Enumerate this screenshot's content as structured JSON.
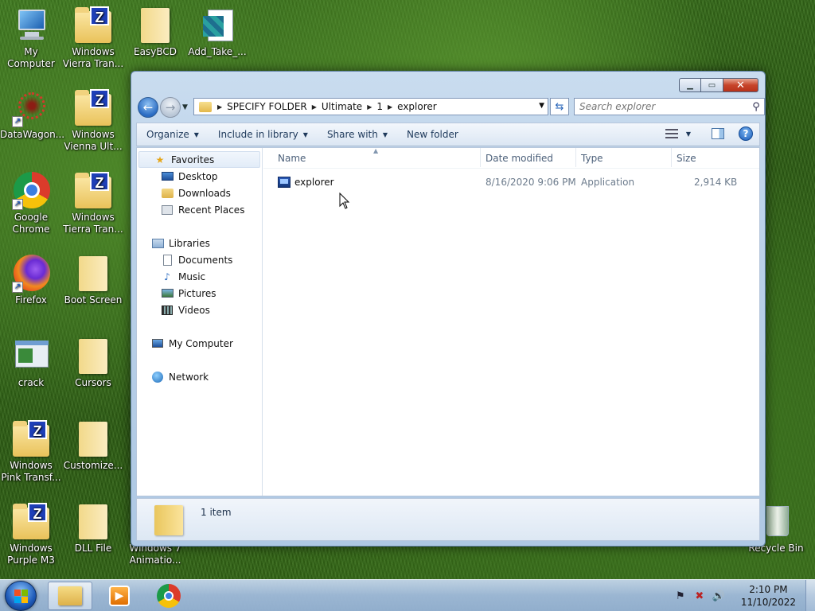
{
  "desktop": {
    "icons": [
      {
        "label": "My Computer",
        "icon": "computer-icon"
      },
      {
        "label": "Windows Vierra Tran...",
        "icon": "folder-z-icon"
      },
      {
        "label": "EasyBCD",
        "icon": "folder-icon"
      },
      {
        "label": "Add_Take_...",
        "icon": "registry-icon"
      },
      {
        "label": "DataWagon...",
        "icon": "shortcut-icon"
      },
      {
        "label": "Windows Vienna Ult...",
        "icon": "folder-z-icon"
      },
      {
        "label": "Google Chrome",
        "icon": "chrome-icon"
      },
      {
        "label": "Windows Tierra Tran...",
        "icon": "folder-z-icon"
      },
      {
        "label": "Firefox",
        "icon": "firefox-icon"
      },
      {
        "label": "Boot Screen",
        "icon": "folder-icon"
      },
      {
        "label": "crack",
        "icon": "window-app-icon"
      },
      {
        "label": "Cursors",
        "icon": "folder-icon"
      },
      {
        "label": "Windows Pink Transf...",
        "icon": "folder-z-icon"
      },
      {
        "label": "Customize...",
        "icon": "folder-icon"
      },
      {
        "label": "Windows Purple M3",
        "icon": "folder-z-icon"
      },
      {
        "label": "DLL File",
        "icon": "folder-icon"
      },
      {
        "label": "Windows 7 Animatio...",
        "icon": "folder-icon"
      },
      {
        "label": "Recycle Bin",
        "icon": "recycle-bin-icon"
      }
    ]
  },
  "window": {
    "address": {
      "crumbs": [
        "SPECIFY FOLDER",
        "Ultimate",
        "1",
        "explorer"
      ]
    },
    "search": {
      "placeholder": "Search explorer"
    },
    "toolbar": {
      "organize": "Organize",
      "include": "Include in library",
      "share": "Share with",
      "new_folder": "New folder"
    },
    "nav": {
      "favorites": "Favorites",
      "desktop": "Desktop",
      "downloads": "Downloads",
      "recent": "Recent Places",
      "libraries": "Libraries",
      "documents": "Documents",
      "music": "Music",
      "pictures": "Pictures",
      "videos": "Videos",
      "computer": "My Computer",
      "network": "Network"
    },
    "columns": {
      "name": "Name",
      "date": "Date modified",
      "type": "Type",
      "size": "Size"
    },
    "files": [
      {
        "name": "explorer",
        "date": "8/16/2020 9:06 PM",
        "type": "Application",
        "size": "2,914 KB"
      }
    ],
    "details": {
      "count": "1 item"
    }
  },
  "taskbar": {
    "time": "2:10 PM",
    "date": "11/10/2022"
  }
}
